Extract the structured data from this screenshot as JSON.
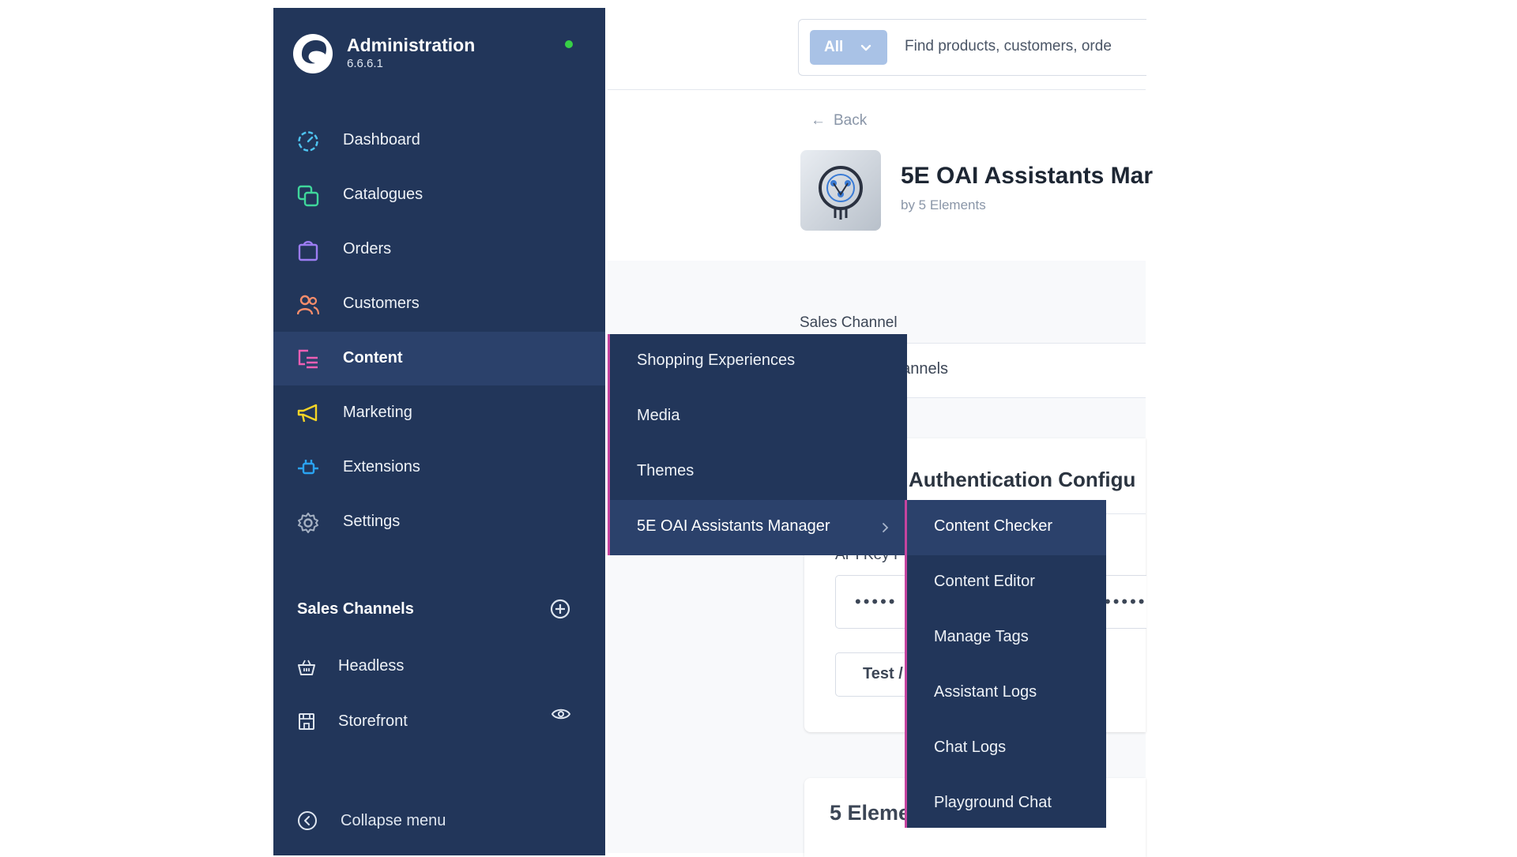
{
  "app": {
    "title": "Administration",
    "version": "6.6.6.1",
    "status_color": "#37d046"
  },
  "sidebar": {
    "items": [
      {
        "label": "Dashboard",
        "icon": "dashboard-icon",
        "color": "#4ec3f0"
      },
      {
        "label": "Catalogues",
        "icon": "catalogues-icon",
        "color": "#3fd69b"
      },
      {
        "label": "Orders",
        "icon": "orders-icon",
        "color": "#9c7cf2"
      },
      {
        "label": "Customers",
        "icon": "customers-icon",
        "color": "#f78d6b"
      },
      {
        "label": "Content",
        "icon": "content-icon",
        "color": "#ef5fb4",
        "active": true
      },
      {
        "label": "Marketing",
        "icon": "marketing-icon",
        "color": "#f5d426"
      },
      {
        "label": "Extensions",
        "icon": "extensions-icon",
        "color": "#2aa3f2"
      },
      {
        "label": "Settings",
        "icon": "settings-icon",
        "color": "#a4b0c2"
      }
    ],
    "sales_channels": {
      "title": "Sales Channels",
      "items": [
        {
          "label": "Headless",
          "icon": "basket-icon"
        },
        {
          "label": "Storefront",
          "icon": "storefront-icon"
        }
      ]
    },
    "collapse_label": "Collapse menu"
  },
  "search": {
    "scope": "All",
    "placeholder": "Find products, customers, orde"
  },
  "header": {
    "back_label": "Back"
  },
  "plugin": {
    "title": "5E OAI Assistants Mar",
    "by": "by 5 Elements"
  },
  "form": {
    "sales_channel_label": "Sales Channel",
    "sales_channel_value": "hannels",
    "auth_title": "Authentication Configu",
    "api_key_label": "API Key I",
    "password_left": "•••••",
    "password_right": "•••••",
    "test_button": "Test /",
    "second_card_title": "5 Eleme"
  },
  "content_menu": {
    "items": [
      "Shopping Experiences",
      "Media",
      "Themes",
      "5E OAI Assistants Manager"
    ],
    "active_index": 3
  },
  "assistants_menu": {
    "items": [
      "Content Checker",
      "Content Editor",
      "Manage Tags",
      "Assistant Logs",
      "Chat Logs",
      "Playground Chat"
    ],
    "active_index": 0
  },
  "colors": {
    "sidebar_bg": "#22365a",
    "active_bg": "#2b416b",
    "accent_line": "#c5449f"
  }
}
